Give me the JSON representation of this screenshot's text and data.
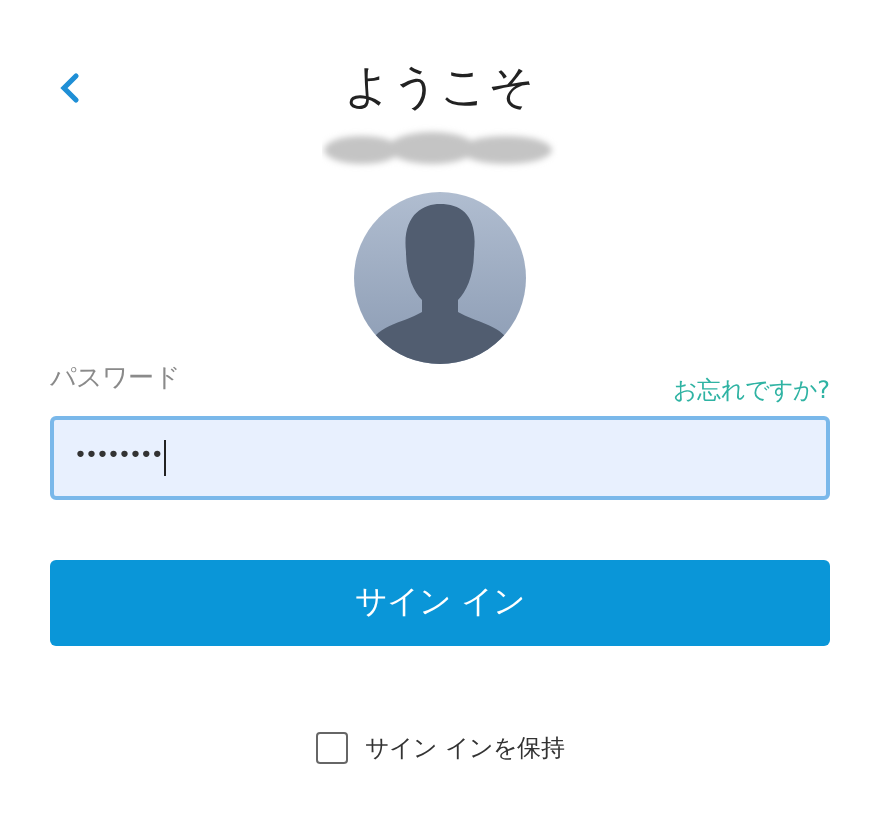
{
  "header": {
    "title": "ようこそ"
  },
  "password": {
    "label": "パスワード",
    "forgot_link": "お忘れですか?",
    "value": "••••••••",
    "focused": true
  },
  "sign_in_button": "サイン イン",
  "keep_signed_in": {
    "label": "サイン インを保持",
    "checked": false
  }
}
